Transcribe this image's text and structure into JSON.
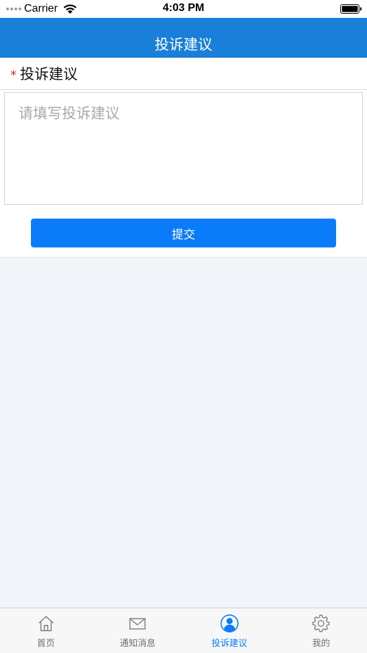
{
  "status_bar": {
    "carrier": "Carrier",
    "time": "4:03 PM"
  },
  "nav": {
    "title": "投诉建议"
  },
  "form": {
    "required_mark": "*",
    "label": "投诉建议",
    "textarea": {
      "value": "",
      "placeholder": "请填写投诉建议"
    },
    "submit_label": "提交"
  },
  "tabs": [
    {
      "label": "首页",
      "icon": "home-icon",
      "active": false
    },
    {
      "label": "通知消息",
      "icon": "mail-icon",
      "active": false
    },
    {
      "label": "投诉建议",
      "icon": "user-icon",
      "active": true
    },
    {
      "label": "我的",
      "icon": "gear-icon",
      "active": false
    }
  ],
  "colors": {
    "nav_background": "#1a7fd9",
    "primary": "#0a7cfa",
    "required": "#e0242a",
    "page_background": "#f2f5fa",
    "tab_inactive": "#6f6f6f"
  }
}
